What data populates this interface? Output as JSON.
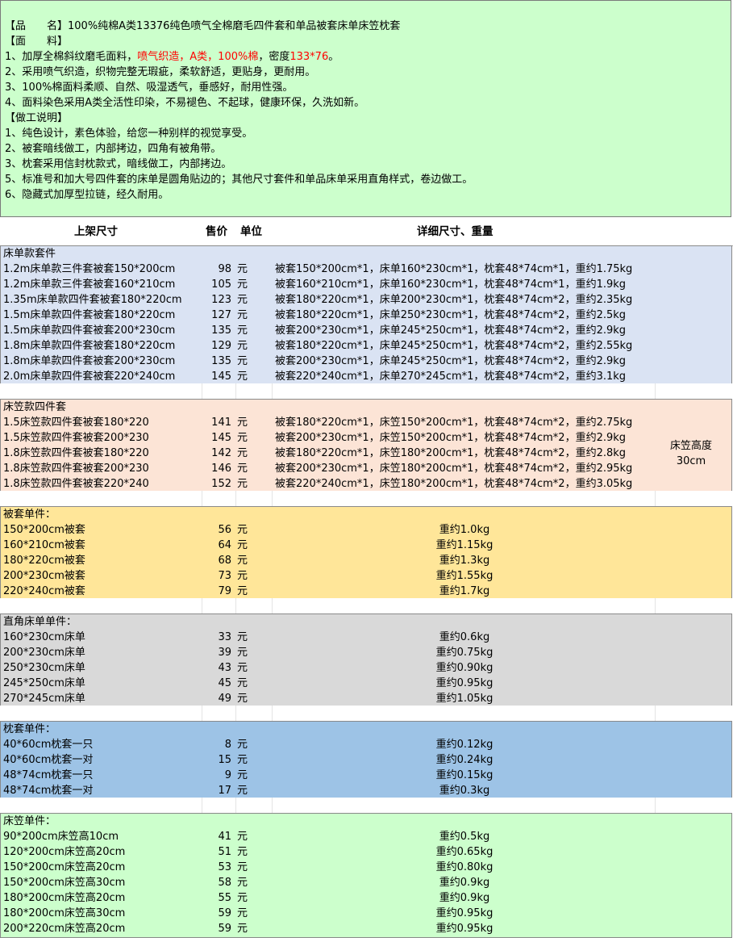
{
  "info": {
    "lines": [
      {
        "text": "【品　　名】100%纯棉A类13376纯色喷气全棉磨毛四件套和单品被套床单床笠枕套"
      },
      {
        "text": "【面　　料】"
      },
      {
        "pre": "1、加厚全棉斜纹磨毛面料，",
        "red": "喷气织造，A类，100%棉",
        "post": "，密度",
        "red2": "133*76",
        "post2": "。"
      },
      {
        "text": "2、采用喷气织造，织物完整无瑕疵，柔软舒适，更贴身，更耐用。"
      },
      {
        "text": "3、100%棉面料柔顺、自然、吸湿透气，垂感好，耐用性强。"
      },
      {
        "text": "4、面料染色采用A类全活性印染，不易褪色、不起球，健康环保，久洗如新。"
      },
      {
        "text": "【做工说明】"
      },
      {
        "text": "1、纯色设计，素色体验，给您一种别样的视觉享受。"
      },
      {
        "text": "2、被套暗线做工，内部拷边，四角有被角带。"
      },
      {
        "text": "3、枕套采用信封枕款式，暗线做工，内部拷边。"
      },
      {
        "text": "5、标准号和加大号四件套的床单是圆角贴边的；其他尺寸套件和单品床单采用直角样式，卷边做工。"
      },
      {
        "text": "6、隐藏式加厚型拉链，经久耐用。"
      }
    ]
  },
  "header": {
    "col1": "上架尺寸",
    "col2": "售价",
    "col3": "单位",
    "col4": "详细尺寸、重量"
  },
  "colors": {
    "info": "#ccffcc",
    "flat": "#dae3f3",
    "fitted": "#fce4d6",
    "duvet": "#ffe699",
    "sheet": "#d9d9d9",
    "pillow": "#9dc3e6",
    "fittedSingle": "#ccffcc"
  },
  "sections": [
    {
      "id": "flat",
      "title": "床单款套件",
      "centered": false,
      "rows": [
        {
          "name": "1.2m床单款三件套被套150*200cm",
          "price": "98",
          "unit": "元",
          "detail": "被套150*200cm*1，床单160*230cm*1，枕套48*74cm*1，重约1.75kg"
        },
        {
          "name": "1.2m床单款三件套被套160*210cm",
          "price": "105",
          "unit": "元",
          "detail": "被套160*210cm*1，床单160*230cm*1，枕套48*74cm*1，重约1.9kg"
        },
        {
          "name": "1.35m床单款四件套被套180*220cm",
          "price": "123",
          "unit": "元",
          "detail": "被套180*220cm*1，床单200*230cm*1，枕套48*74cm*2，重约2.35kg"
        },
        {
          "name": "1.5m床单款四件套被套180*220cm",
          "price": "127",
          "unit": "元",
          "detail": "被套180*220cm*1，床单250*230cm*1，枕套48*74cm*2，重约2.5kg"
        },
        {
          "name": "1.5m床单款四件套被套200*230cm",
          "price": "135",
          "unit": "元",
          "detail": "被套200*230cm*1，床单245*250cm*1，枕套48*74cm*2，重约2.9kg"
        },
        {
          "name": "1.8m床单款四件套被套180*220cm",
          "price": "129",
          "unit": "元",
          "detail": "被套180*220cm*1，床单245*250cm*1，枕套48*74cm*2，重约2.55kg"
        },
        {
          "name": "1.8m床单款四件套被套200*230cm",
          "price": "135",
          "unit": "元",
          "detail": "被套200*230cm*1，床单245*250cm*1，枕套48*74cm*2，重约2.9kg"
        },
        {
          "name": "2.0m床单款四件套被套220*240cm",
          "price": "145",
          "unit": "元",
          "detail": "被套220*240cm*1，床单270*245cm*1，枕套48*74cm*2，重约3.1kg"
        }
      ]
    },
    {
      "id": "fitted",
      "title": "床笠款四件套",
      "centered": false,
      "side_line1": "床笠高度",
      "side_line2": "30cm",
      "rows": [
        {
          "name": "1.5床笠款四件套被套180*220",
          "price": "141",
          "unit": "元",
          "detail": "被套180*220cm*1，床笠150*200cm*1，枕套48*74cm*2，重约2.75kg"
        },
        {
          "name": "1.5床笠款四件套被套200*230",
          "price": "145",
          "unit": "元",
          "detail": "被套200*230cm*1，床笠150*200cm*1，枕套48*74cm*2，重约2.9kg"
        },
        {
          "name": "1.8床笠款四件套被套180*220",
          "price": "142",
          "unit": "元",
          "detail": "被套180*220cm*1，床笠180*200cm*1，枕套48*74cm*2，重约2.8kg"
        },
        {
          "name": "1.8床笠款四件套被套200*230",
          "price": "146",
          "unit": "元",
          "detail": "被套200*230cm*1，床笠180*200cm*1，枕套48*74cm*2，重约2.95kg"
        },
        {
          "name": "1.8床笠款四件套被套220*240",
          "price": "152",
          "unit": "元",
          "detail": "被套220*240cm*1，床笠180*200cm*1，枕套48*74cm*2，重约3.05kg"
        }
      ]
    },
    {
      "id": "duvet",
      "title": "被套单件：",
      "centered": true,
      "rows": [
        {
          "name": "150*200cm被套",
          "price": "56",
          "unit": "元",
          "detail": "重约1.0kg"
        },
        {
          "name": "160*210cm被套",
          "price": "64",
          "unit": "元",
          "detail": "重约1.15kg"
        },
        {
          "name": "180*220cm被套",
          "price": "68",
          "unit": "元",
          "detail": "重约1.3kg"
        },
        {
          "name": "200*230cm被套",
          "price": "73",
          "unit": "元",
          "detail": "重约1.55kg"
        },
        {
          "name": "220*240cm被套",
          "price": "79",
          "unit": "元",
          "detail": "重约1.7kg"
        }
      ]
    },
    {
      "id": "sheet",
      "title": "直角床单单件：",
      "centered": true,
      "rows": [
        {
          "name": "160*230cm床单",
          "price": "33",
          "unit": "元",
          "detail": "重约0.6kg"
        },
        {
          "name": "200*230cm床单",
          "price": "39",
          "unit": "元",
          "detail": "重约0.75kg"
        },
        {
          "name": "250*230cm床单",
          "price": "43",
          "unit": "元",
          "detail": "重约0.90kg"
        },
        {
          "name": "245*250cm床单",
          "price": "45",
          "unit": "元",
          "detail": "重约0.95kg"
        },
        {
          "name": "270*245cm床单",
          "price": "49",
          "unit": "元",
          "detail": "重约1.05kg"
        }
      ]
    },
    {
      "id": "pillow",
      "title": "枕套单件：",
      "centered": true,
      "rows": [
        {
          "name": "40*60cm枕套一只",
          "price": "8",
          "unit": "元",
          "detail": "重约0.12kg"
        },
        {
          "name": "40*60cm枕套一对",
          "price": "15",
          "unit": "元",
          "detail": "重约0.24kg"
        },
        {
          "name": "48*74cm枕套一只",
          "price": "9",
          "unit": "元",
          "detail": "重约0.15kg"
        },
        {
          "name": "48*74cm枕套一对",
          "price": "17",
          "unit": "元",
          "detail": "重约0.3kg"
        }
      ]
    },
    {
      "id": "fittedSingle",
      "title": "床笠单件：",
      "centered": true,
      "rows": [
        {
          "name": "90*200cm床笠高10cm",
          "price": "41",
          "unit": "元",
          "detail": "重约0.5kg"
        },
        {
          "name": "120*200cm床笠高20cm",
          "price": "51",
          "unit": "元",
          "detail": "重约0.65kg"
        },
        {
          "name": "150*200cm床笠高20cm",
          "price": "53",
          "unit": "元",
          "detail": "重约0.80kg"
        },
        {
          "name": "150*200cm床笠高30cm",
          "price": "58",
          "unit": "元",
          "detail": "重约0.9kg"
        },
        {
          "name": "180*200cm床笠高20cm",
          "price": "55",
          "unit": "元",
          "detail": "重约0.9kg"
        },
        {
          "name": "180*200cm床笠高30cm",
          "price": "59",
          "unit": "元",
          "detail": "重约0.95kg"
        },
        {
          "name": "200*220cm床笠高20cm",
          "price": "59",
          "unit": "元",
          "detail": "重约0.95kg"
        }
      ]
    }
  ]
}
